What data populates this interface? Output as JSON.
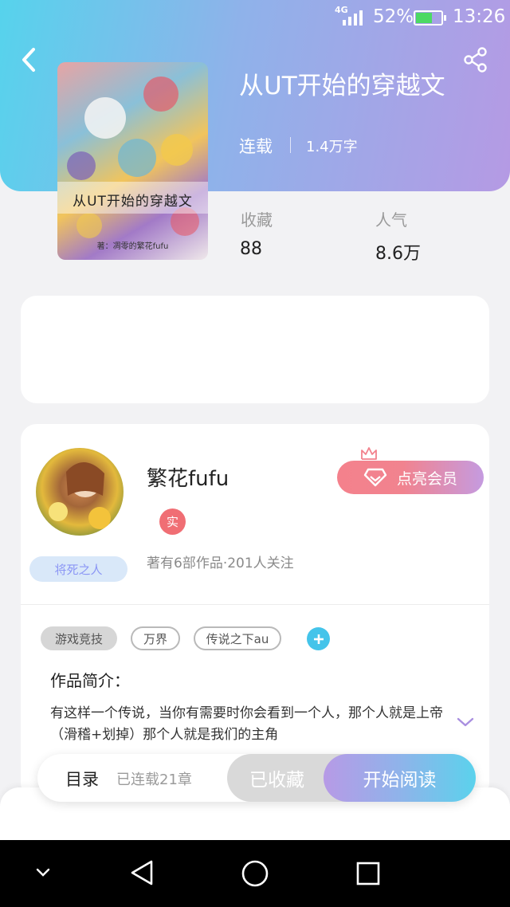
{
  "status_bar": {
    "network": "4G",
    "battery": "52%",
    "time": "13:26"
  },
  "book": {
    "title": "从UT开始的穿越文",
    "status": "连载",
    "word_count": "1.4万字",
    "cover_title": "从UT开始的穿越文",
    "cover_author": "著：凋零的繁花fufu",
    "stats": [
      {
        "label": "收藏",
        "value": "88"
      },
      {
        "label": "人气",
        "value": "8.6万"
      }
    ]
  },
  "author": {
    "name": "繁花fufu",
    "verified_label": "实",
    "title_tag": "将死之人",
    "stats": "著有6部作品·201人关注",
    "vip_button": "点亮会员"
  },
  "tags": [
    "游戏竞技",
    "万界",
    "传说之下au"
  ],
  "synopsis": {
    "heading": "作品简介：",
    "text": "有这样一个传说，当你有需要时你会看到一个人，那个人就是上帝（滑稽+划掉）那个人就是我们的主角"
  },
  "actions": {
    "toc": "目录",
    "chapters": "已连载21章",
    "collected": "已收藏",
    "start_reading": "开始阅读"
  },
  "colors": {
    "header_start": "#56d3ec",
    "header_end": "#b59ae4",
    "accent_blue": "#44c4ea",
    "vip_pink": "#f4818c"
  }
}
